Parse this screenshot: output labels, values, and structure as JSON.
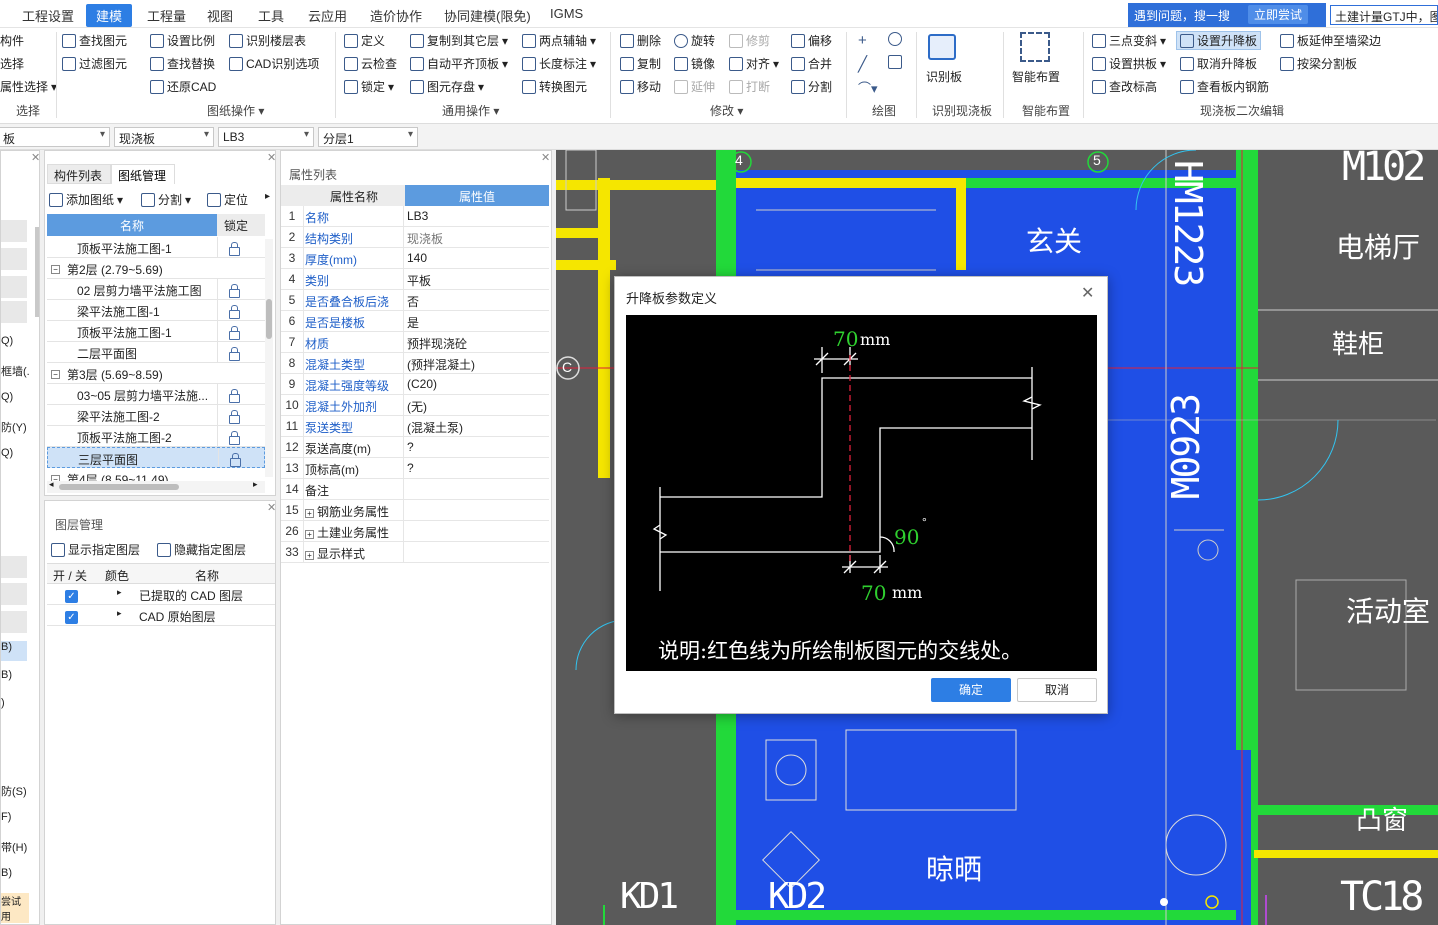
{
  "menu": {
    "items": [
      "工程设置",
      "建模",
      "工程量",
      "视图",
      "工具",
      "云应用",
      "造价协作",
      "协同建模(限免)",
      "IGMS"
    ],
    "active": "建模",
    "hint": "遇到问题，搜一搜",
    "hint_button": "立即尝试",
    "search_value": "土建计量GTJ中，图"
  },
  "ribbon": {
    "select_group": {
      "items": [
        "构件",
        "选择",
        "属性选择"
      ],
      "label": "选择"
    },
    "drawing_ops": {
      "items": [
        "查找图元",
        "过滤图元",
        "设置比例",
        "查找替换",
        "还原CAD",
        "识别楼层表",
        "CAD识别选项"
      ],
      "label": "图纸操作"
    },
    "general_ops": {
      "items": [
        "定义",
        "云检查",
        "锁定",
        "复制到其它层",
        "自动平齐顶板",
        "图元存盘",
        "两点辅轴",
        "长度标注",
        "转换图元"
      ],
      "label": "通用操作"
    },
    "modify": {
      "items": [
        "删除",
        "复制",
        "移动",
        "旋转",
        "镜像",
        "延伸",
        "修剪",
        "对齐",
        "打断",
        "偏移",
        "合并",
        "分割"
      ],
      "label": "修改"
    },
    "draw": {
      "label": "绘图"
    },
    "identify": {
      "button": "识别板",
      "label": "识别现浇板"
    },
    "smart": {
      "button": "智能布置",
      "label": "智能布置"
    },
    "secondary": {
      "items": [
        "三点变斜",
        "设置升降板",
        "板延伸至墙梁边",
        "设置拱板",
        "取消升降板",
        "按梁分割板",
        "查改标高",
        "查看板内钢筋"
      ],
      "label": "现浇板二次编辑"
    }
  },
  "selectors": [
    "板",
    "现浇板",
    "LB3",
    "分层1"
  ],
  "left_panel": {
    "tabs": [
      "构件列表",
      "图纸管理"
    ],
    "toolbar": [
      "添加图纸",
      "分割",
      "定位"
    ],
    "columns": [
      "名称",
      "锁定"
    ],
    "rows": [
      {
        "name": "顶板平法施工图-1",
        "level": 1
      },
      {
        "name": "第2层 (2.79~5.69)",
        "level": 0
      },
      {
        "name": "02 层剪力墙平法施工图",
        "level": 1
      },
      {
        "name": "梁平法施工图-1",
        "level": 1
      },
      {
        "name": "顶板平法施工图-1",
        "level": 1
      },
      {
        "name": "二层平面图",
        "level": 1
      },
      {
        "name": "第3层 (5.69~8.59)",
        "level": 0
      },
      {
        "name": "03~05 层剪力墙平法施...",
        "level": 1
      },
      {
        "name": "梁平法施工图-2",
        "level": 1
      },
      {
        "name": "顶板平法施工图-2",
        "level": 1
      },
      {
        "name": "三层平面图",
        "level": 1
      },
      {
        "name": "第4层 (8.59~11.49)",
        "level": 0
      }
    ],
    "layer_title": "图层管理",
    "layer_toolbar": [
      "显示指定图层",
      "隐藏指定图层"
    ],
    "layer_columns": [
      "开 / 关",
      "颜色",
      "名称"
    ],
    "layers": [
      "已提取的 CAD 图层",
      "CAD 原始图层"
    ]
  },
  "side_strip": [
    "Q)",
    "框墙(.",
    "Q)",
    "防(Y)",
    "Q)",
    "B)",
    "B)",
    ")",
    "防(S)",
    "F)",
    "带(H)",
    "B)",
    "尝试用"
  ],
  "properties": {
    "title": "属性列表",
    "columns": [
      "属性名称",
      "属性值"
    ],
    "rows": [
      {
        "num": "1",
        "name": "名称",
        "value": "LB3",
        "blue": true
      },
      {
        "num": "2",
        "name": "结构类别",
        "value": "现浇板",
        "blue": true,
        "grey": true
      },
      {
        "num": "3",
        "name": "厚度(mm)",
        "value": "140",
        "blue": true
      },
      {
        "num": "4",
        "name": "类别",
        "value": "平板",
        "blue": true
      },
      {
        "num": "5",
        "name": "是否叠合板后浇",
        "value": "否",
        "blue": true
      },
      {
        "num": "6",
        "name": "是否是楼板",
        "value": "是",
        "blue": true
      },
      {
        "num": "7",
        "name": "材质",
        "value": "预拌现浇砼",
        "blue": true
      },
      {
        "num": "8",
        "name": "混凝土类型",
        "value": "(预拌混凝土)",
        "blue": true
      },
      {
        "num": "9",
        "name": "混凝土强度等级",
        "value": "(C20)",
        "blue": true
      },
      {
        "num": "10",
        "name": "混凝土外加剂",
        "value": "(无)",
        "blue": true
      },
      {
        "num": "11",
        "name": "泵送类型",
        "value": "(混凝土泵)",
        "blue": true
      },
      {
        "num": "12",
        "name": "泵送高度(m)",
        "value": "?",
        "blue": false
      },
      {
        "num": "13",
        "name": "顶标高(m)",
        "value": "?",
        "blue": false
      },
      {
        "num": "14",
        "name": "备注",
        "value": "",
        "blue": false
      },
      {
        "num": "15",
        "name": "钢筋业务属性",
        "value": "",
        "expand": true
      },
      {
        "num": "26",
        "name": "土建业务属性",
        "value": "",
        "expand": true
      },
      {
        "num": "33",
        "name": "显示样式",
        "value": "",
        "expand": true
      }
    ]
  },
  "canvas": {
    "axis_labels": [
      "4",
      "5",
      "C"
    ],
    "room_labels": [
      "玄关",
      "电梯厅",
      "鞋柜",
      "活动室",
      "凸窗",
      "晾晒"
    ],
    "tags": [
      "HM1223",
      "M0923",
      "M102",
      "KD1",
      "KD2",
      "TC18"
    ]
  },
  "dialog": {
    "title": "升降板参数定义",
    "dim_top": "70",
    "dim_bottom": "70",
    "unit": "mm",
    "angle": "90",
    "degree": "°",
    "note": "说明:红色线为所绘制板图元的交线处。",
    "ok": "确定",
    "cancel": "取消"
  },
  "colors": {
    "accent": "#2d7ee4",
    "canvas_blue": "#1f4fe6",
    "canvas_green": "#22d93a",
    "canvas_yellow": "#f5e600",
    "dim_green": "#2fd02f"
  }
}
